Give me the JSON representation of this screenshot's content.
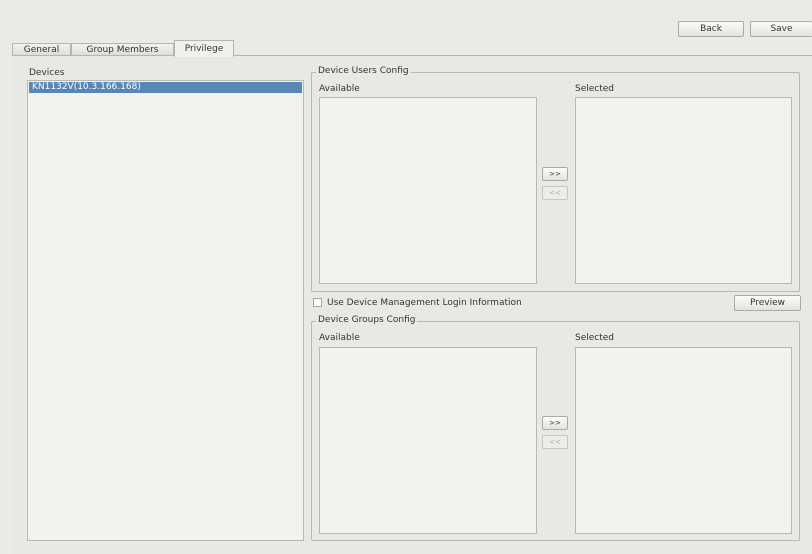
{
  "toolbar": {
    "back_label": "Back",
    "save_label": "Save"
  },
  "tabs": [
    {
      "label": "General",
      "active": false
    },
    {
      "label": "Group Members",
      "active": false
    },
    {
      "label": "Privilege",
      "active": true
    }
  ],
  "devices": {
    "label": "Devices",
    "items": [
      {
        "label": "KN1132V(10.3.166.168)",
        "selected": true
      }
    ]
  },
  "users_config": {
    "title": "Device Users Config",
    "available_label": "Available",
    "selected_label": "Selected",
    "add_label": ">>",
    "remove_label": "<<"
  },
  "login_option": {
    "label": "Use Device Management Login Information",
    "checked": false
  },
  "preview_label": "Preview",
  "groups_config": {
    "title": "Device Groups Config",
    "available_label": "Available",
    "selected_label": "Selected",
    "add_label": ">>",
    "remove_label": "<<"
  },
  "colors": {
    "selection": "#5a86b4",
    "background": "#ebebe6"
  }
}
